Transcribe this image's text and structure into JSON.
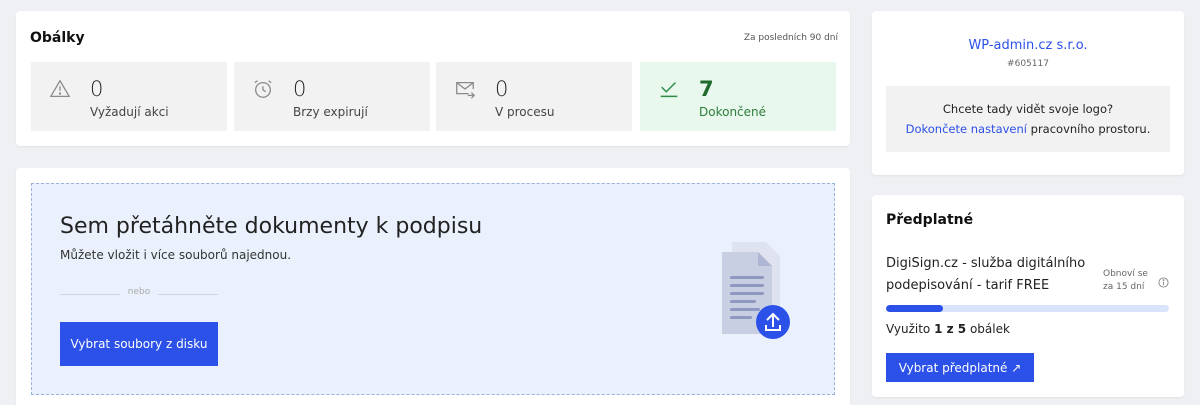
{
  "envelopes": {
    "title": "Obálky",
    "period": "Za posledních 90 dní",
    "stats": [
      {
        "count": "0",
        "label": "Vyžadují akci",
        "icon": "warning-icon"
      },
      {
        "count": "0",
        "label": "Brzy expirují",
        "icon": "alarm-clock-icon"
      },
      {
        "count": "0",
        "label": "V procesu",
        "icon": "envelope-send-icon"
      },
      {
        "count": "7",
        "label": "Dokončené",
        "icon": "check-icon"
      }
    ]
  },
  "upload": {
    "title": "Sem přetáhněte dokumenty k podpisu",
    "subtitle": "Můžete vložit i více souborů najednou.",
    "or_text": "nebo",
    "button_label": "Vybrat soubory z disku",
    "illustration_icon": "document-upload-icon"
  },
  "company": {
    "name": "WP-admin.cz s.r.o.",
    "id": "#605117",
    "logo_question": "Chcete tady vidět svoje logo?",
    "logo_link": "Dokončete nastavení",
    "logo_rest": " pracovního prostoru."
  },
  "subscription": {
    "title": "Předplatné",
    "plan": "DigiSign.cz - služba digitálního podepisování - tarif FREE",
    "renew_line1": "Obnoví se",
    "renew_line2": "za 15 dní",
    "used_prefix": "Využito ",
    "used_value": "1 z 5",
    "used_suffix": " obálek",
    "usage_fraction": 0.2,
    "button_label": "Vybrat předplatné ↗"
  },
  "colors": {
    "accent": "#2b51e8",
    "success_bg": "#e8f8ec",
    "success_text": "#1f6b2e",
    "drop_zone_bg": "#eaf1fd"
  }
}
